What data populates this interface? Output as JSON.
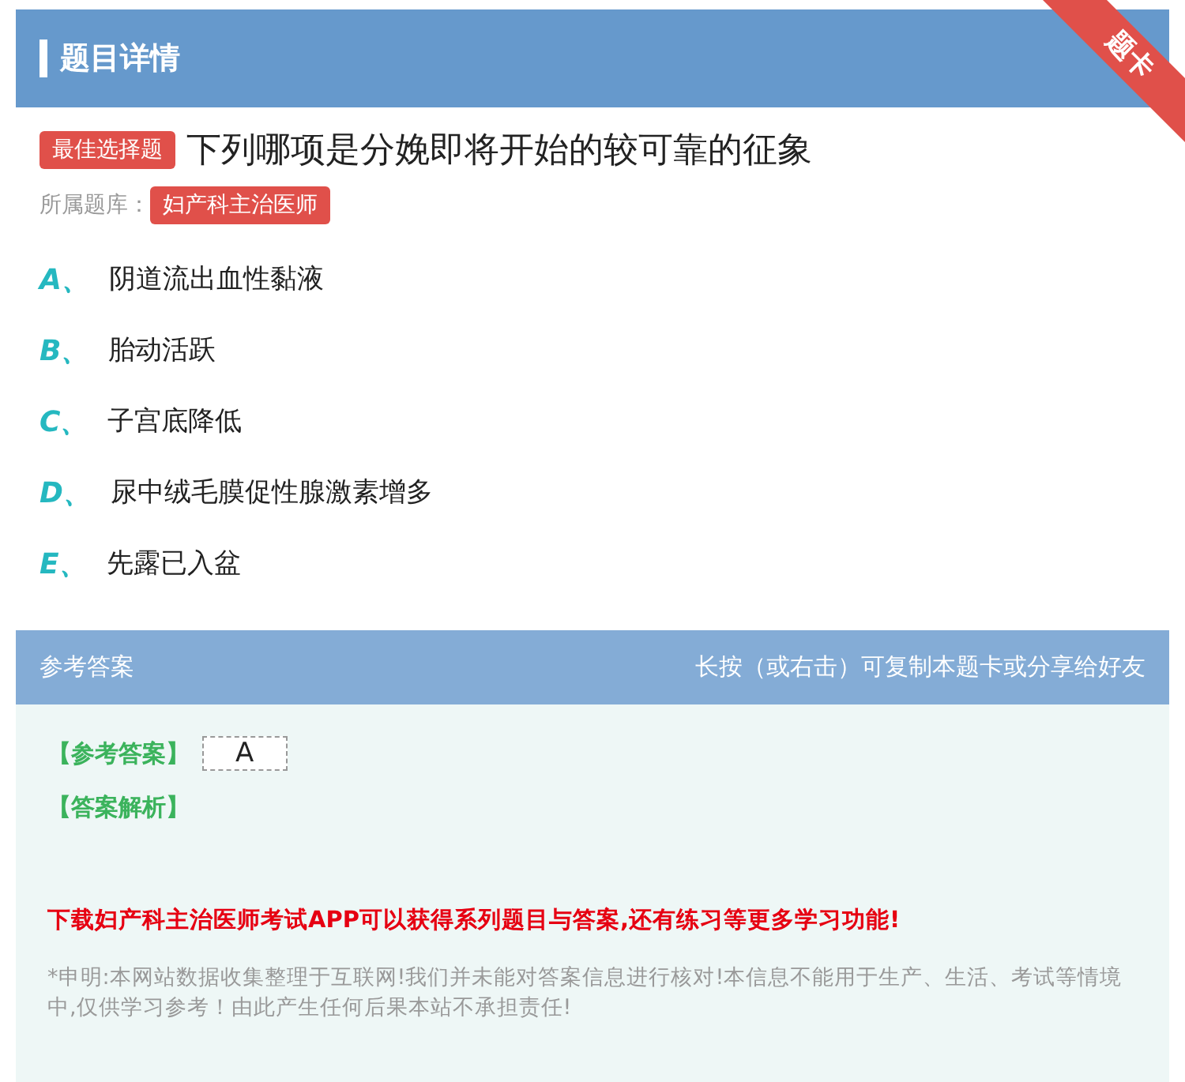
{
  "header": {
    "title": "题目详情",
    "ribbon": "题卡"
  },
  "question": {
    "type_badge": "最佳选择题",
    "text": "下列哪项是分娩即将开始的较可靠的征象",
    "bank_label": "所属题库：",
    "bank": "妇产科主治医师"
  },
  "options": [
    {
      "letter": "A、",
      "text": "阴道流出血性黏液"
    },
    {
      "letter": "B、",
      "text": "胎动活跃"
    },
    {
      "letter": "C、",
      "text": "子宫底降低"
    },
    {
      "letter": "D、",
      "text": "尿中绒毛膜促性腺激素增多"
    },
    {
      "letter": "E、",
      "text": "先露已入盆"
    }
  ],
  "answer_section": {
    "title": "参考答案",
    "hint": "长按（或右击）可复制本题卡或分享给好友",
    "answer_label": "【参考答案】",
    "answer": "A",
    "analysis_label": "【答案解析】",
    "promo": "下载妇产科主治医师考试APP可以获得系列题目与答案,还有练习等更多学习功能!",
    "disclaimer": "*申明:本网站数据收集整理于互联网!我们并未能对答案信息进行核对!本信息不能用于生产、生活、考试等情境中,仅供学习参考！由此产生任何后果本站不承担责任!"
  }
}
